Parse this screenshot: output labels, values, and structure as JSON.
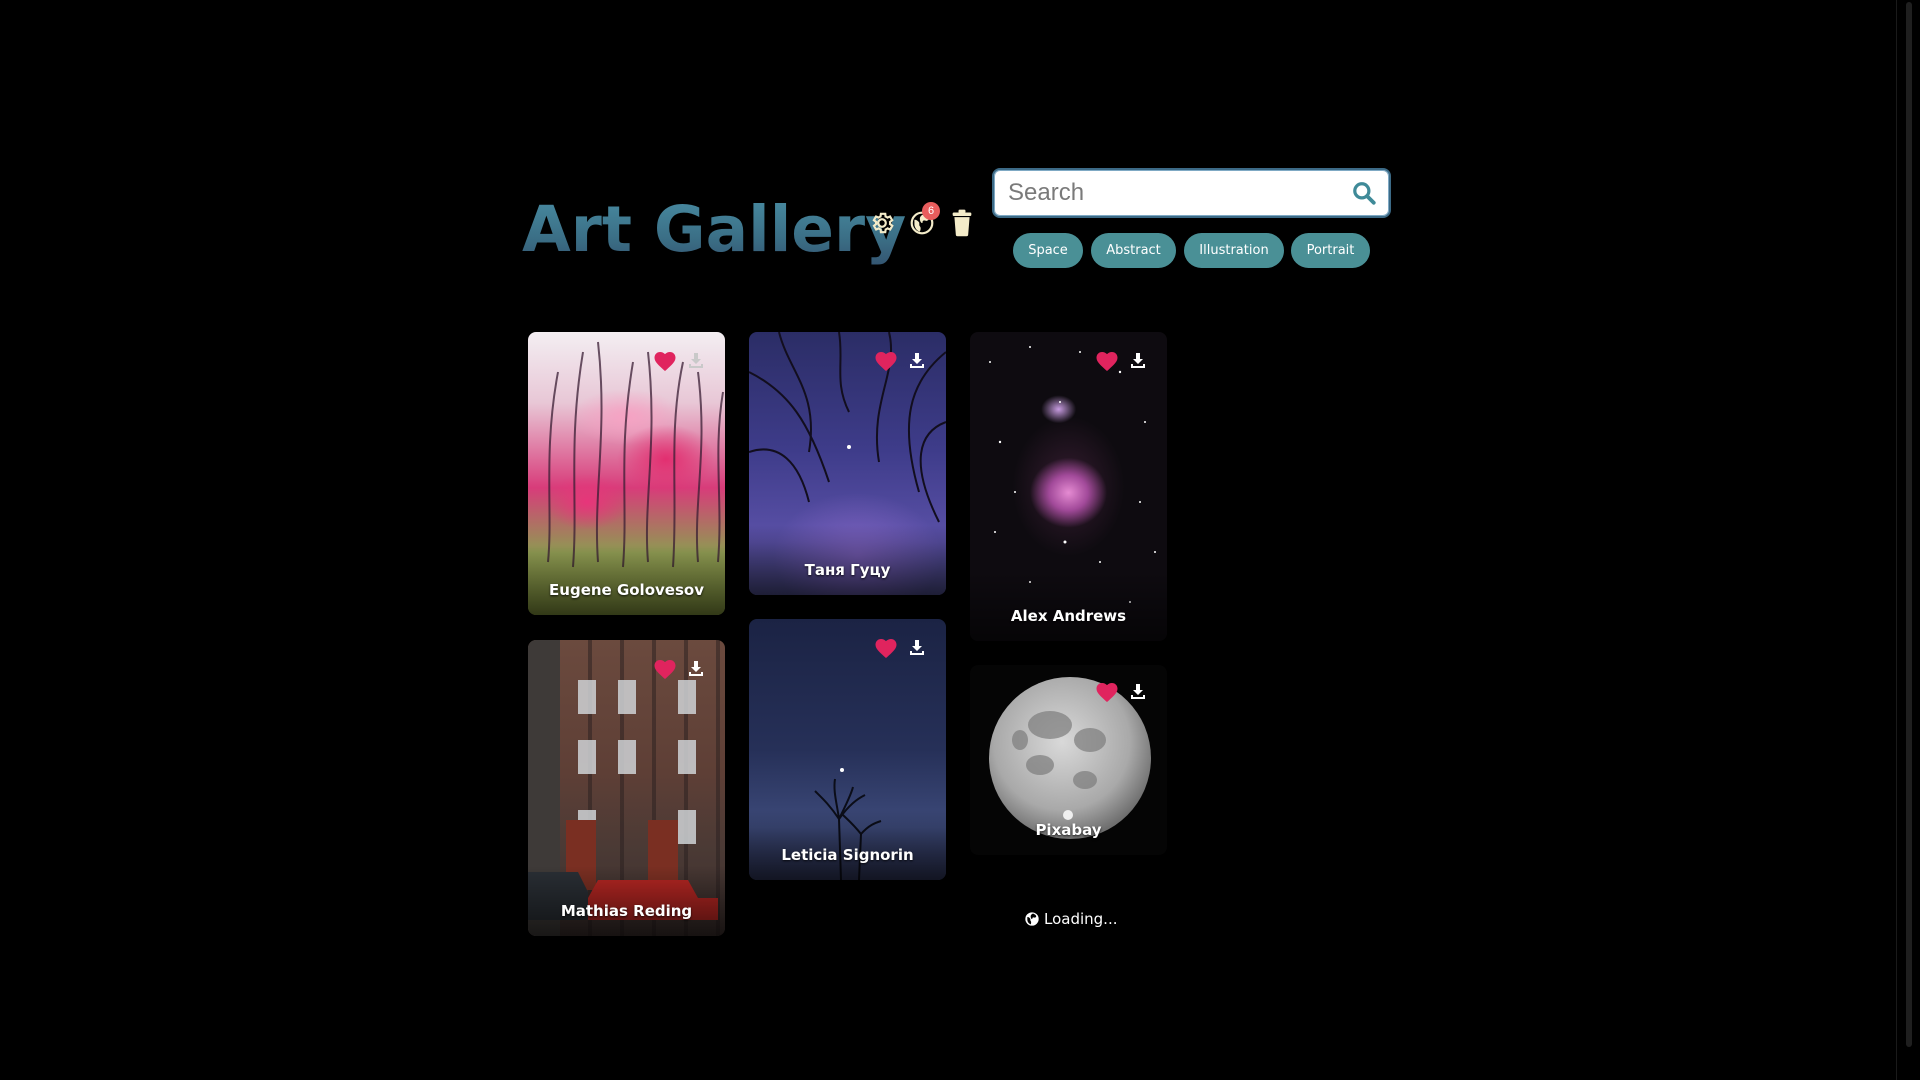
{
  "header": {
    "title": "Art Gallery",
    "settings_icon": "gear-icon",
    "favorites_icon": "globe-heart-icon",
    "favorites_count": "6",
    "trash_icon": "trash-icon"
  },
  "search": {
    "placeholder": "Search",
    "value": "",
    "button_icon": "search-icon"
  },
  "categories": [
    "Space",
    "Abstract",
    "Illustration",
    "Portrait"
  ],
  "cards": [
    {
      "author": "Eugene Golovesov",
      "liked": true,
      "art": "pink-blossom-trees"
    },
    {
      "author": "Таня Гуцу",
      "liked": true,
      "art": "branches-purple-sky"
    },
    {
      "author": "Alex Andrews",
      "liked": true,
      "art": "orion-nebula"
    },
    {
      "author": "Mathias Reding",
      "liked": true,
      "art": "brick-building-red-car"
    },
    {
      "author": "Leticia Signorin",
      "liked": true,
      "art": "dusk-sky-palm"
    },
    {
      "author": "Pixabay",
      "liked": true,
      "art": "full-moon"
    }
  ],
  "status": {
    "loading_text": "Loading...",
    "loading_icon": "globe-icon"
  },
  "colors": {
    "accent": "#4a9096",
    "title": "#3f7e93",
    "heart": "#e0245e",
    "badge": "#e85d5d",
    "background": "#000000"
  }
}
